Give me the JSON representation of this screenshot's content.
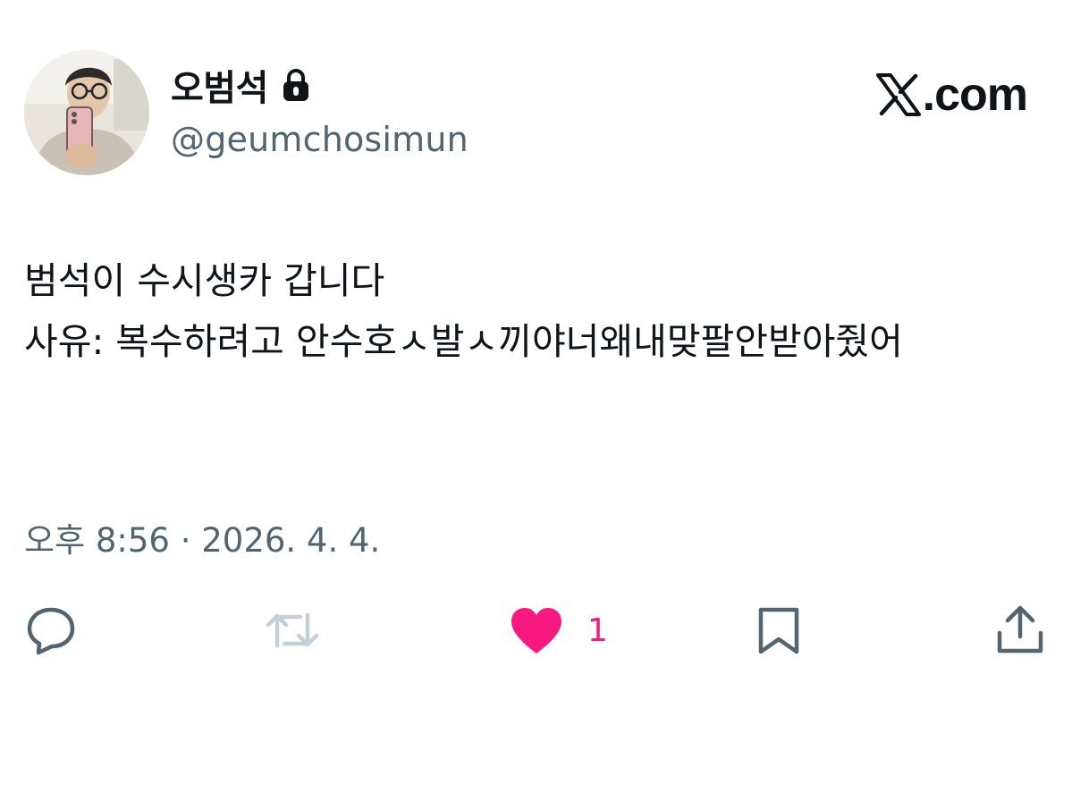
{
  "author": {
    "display_name": "오범석",
    "handle": "@geumchosimun",
    "protected_icon": "lock-icon",
    "avatar": "profile-photo"
  },
  "brand": {
    "logo_icon": "x-logo-icon",
    "text": ".com"
  },
  "tweet": {
    "text": "범석이 수시생카 갑니다\n사유: 복수하려고 안수호ㅅ발ㅅ끼야너왜내맞팔안받아줬어",
    "time": "오후 8:56",
    "separator": "·",
    "date": "2026. 4. 4."
  },
  "actions": {
    "reply_icon": "reply-icon",
    "retweet_icon": "retweet-icon",
    "like_icon": "heart-icon",
    "like_count": "1",
    "bookmark_icon": "bookmark-icon",
    "share_icon": "share-icon"
  },
  "colors": {
    "text": "#0f1419",
    "secondary": "#536471",
    "like": "#f91880",
    "retweet_disabled": "#c4cfd6"
  }
}
